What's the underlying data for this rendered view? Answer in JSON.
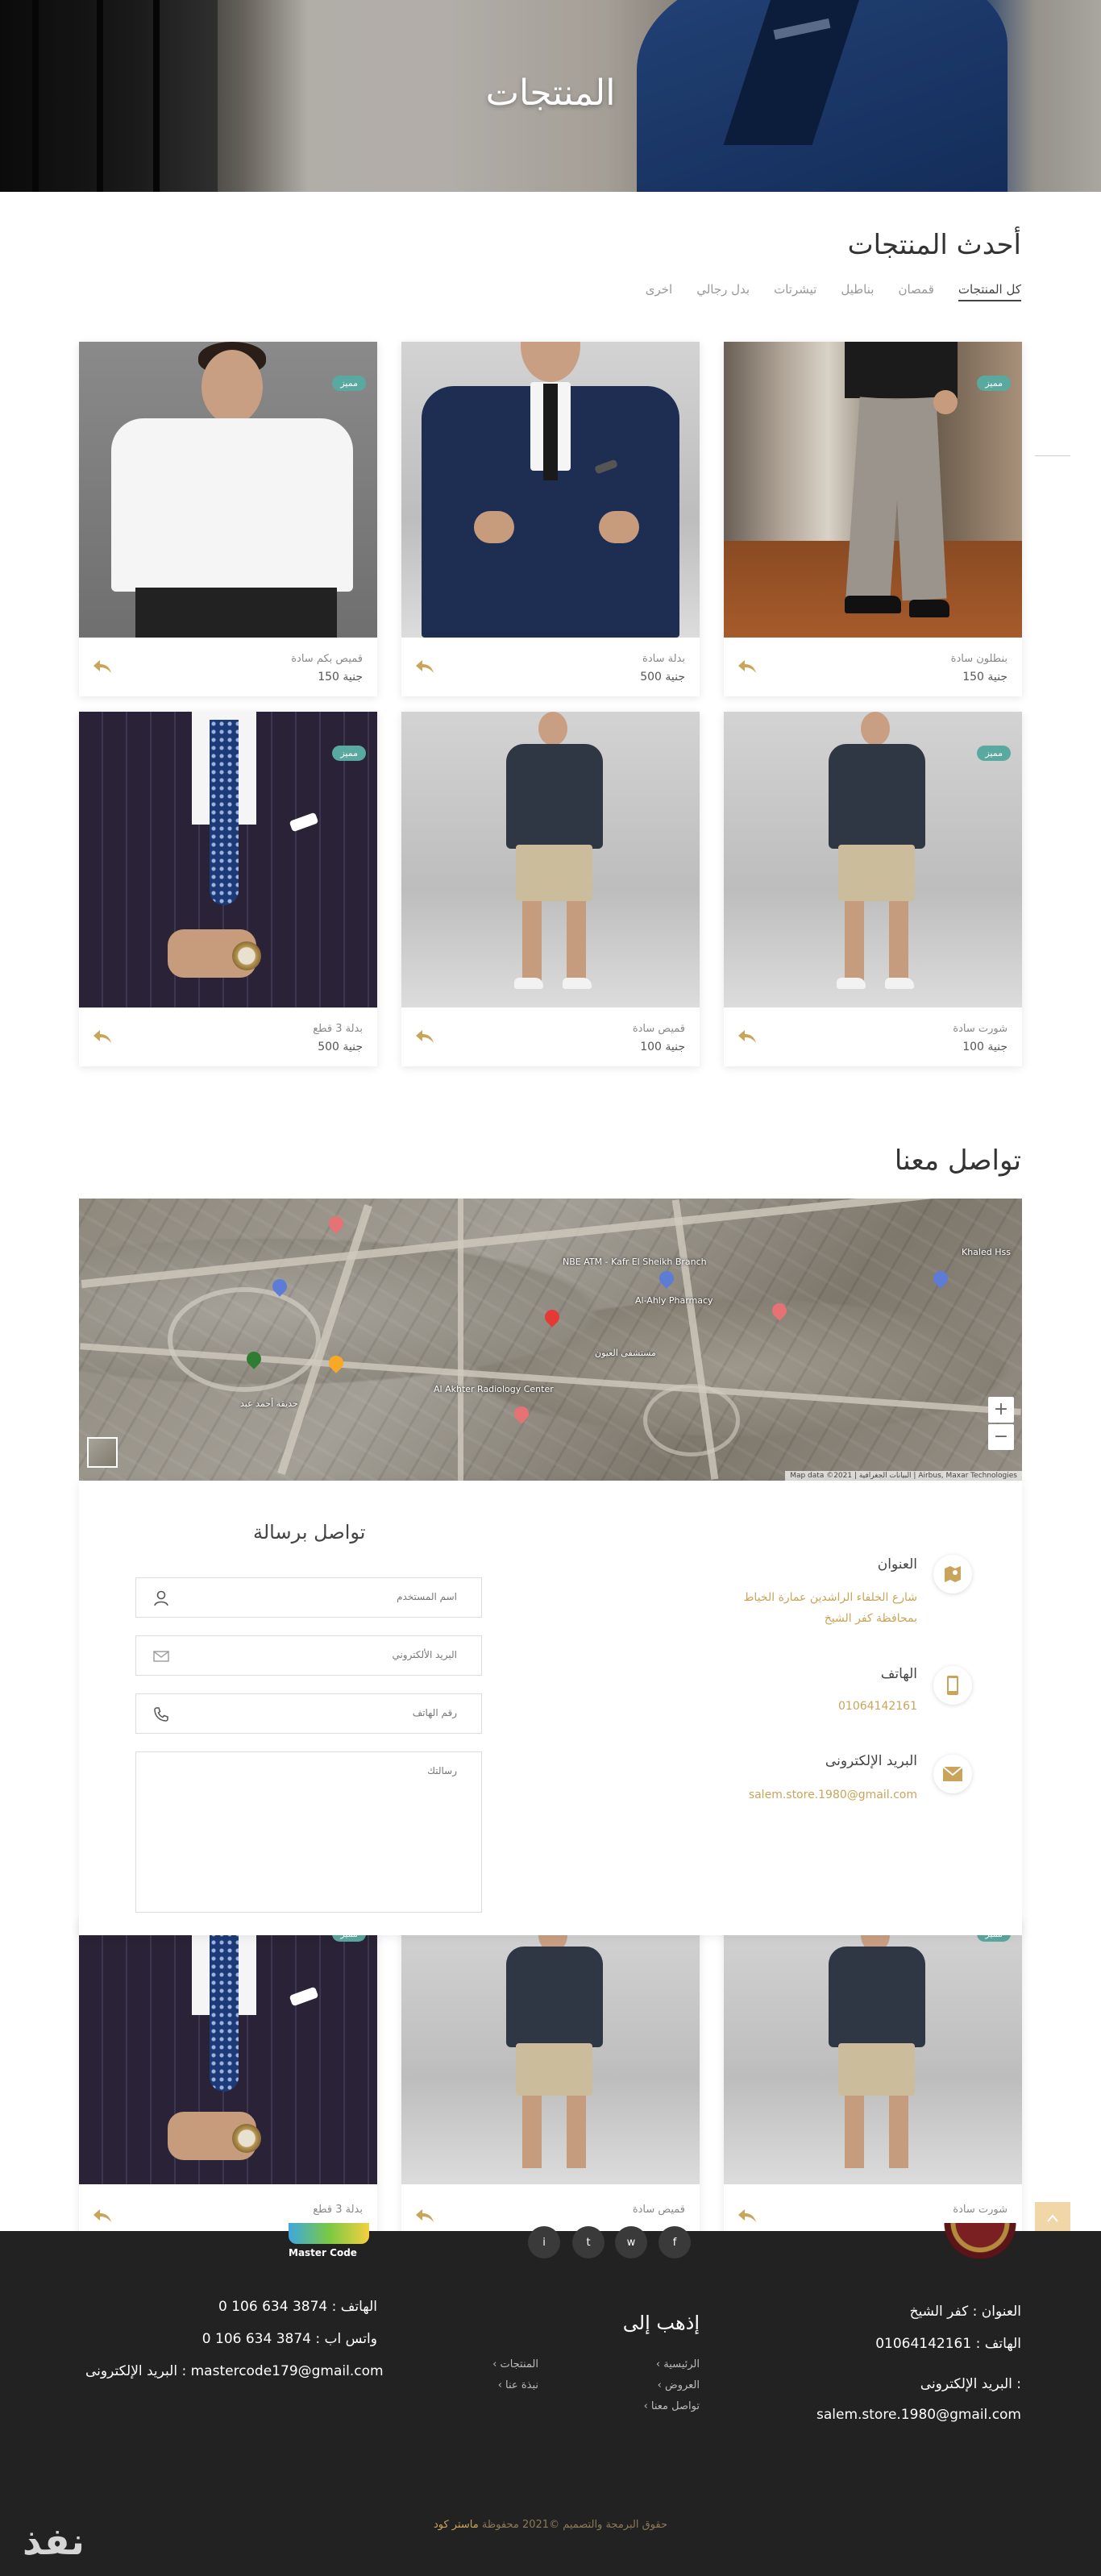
{
  "hero": {
    "title": "المنتجات"
  },
  "latest": {
    "title": "أحدث المنتجات",
    "tabs": [
      "كل المنتجات",
      "قمصان",
      "بناطيل",
      "تيشرتات",
      "بدل رجالي",
      "اخرى"
    ]
  },
  "products": [
    {
      "name": "بنطلون سادة",
      "price": "150 جنية",
      "badge": "مميز"
    },
    {
      "name": "بدلة سادة",
      "price": "500 جنية",
      "badge": ""
    },
    {
      "name": "قميص بكم سادة",
      "price": "150 جنية",
      "badge": "مميز"
    },
    {
      "name": "شورت سادة",
      "price": "100 جنية",
      "badge": "مميز"
    },
    {
      "name": "قميص سادة",
      "price": "100 جنية",
      "badge": ""
    },
    {
      "name": "بدلة 3 قطع",
      "price": "500 جنية",
      "badge": "مميز"
    }
  ],
  "overflow_products": [
    {
      "name": "شورت سادة",
      "badge": "مميز"
    },
    {
      "name": "قميص سادة",
      "badge": ""
    },
    {
      "name": "بدلة 3 قطع",
      "badge": "مميز"
    }
  ],
  "contact": {
    "title": "تواصل معنا",
    "form_title": "تواصل برسالة",
    "fields": {
      "username_placeholder": "اسم المستخدم",
      "email_placeholder": "البريد الألكتروني",
      "phone_placeholder": "رقم الهاتف",
      "message_placeholder": "رسالتك"
    },
    "address_label": "العنوان",
    "address_value": "شارع الخلفاء الراشدين عمارة الخياط بمحافظة كفر الشيخ",
    "phone_label": "الهاتف",
    "phone_value": "01064142161",
    "email_label": "البريد الإلكترونى",
    "email_value": "salem.store.1980@gmail.com"
  },
  "map": {
    "labels": [
      "NBE ATM - Kafr El Sheikh Branch",
      "Al-Ahly Pharmacy",
      "Al Akhter Radiology Center",
      "مستشفى العيون",
      "Khaled Hss",
      "حديقة أحمد عبد"
    ],
    "zoom_in": "+",
    "zoom_out": "−",
    "attribution": "Map data ©2021 | البيانات الجغرافية | Airbus, Maxar Technologies"
  },
  "footer": {
    "address": "العنوان : كفر الشيخ",
    "phone": "الهاتف : 01064142161",
    "email_label": "البريد الإلكترونى :",
    "email": "salem.store.1980@gmail.com",
    "goto_title": "إذهب إلى",
    "links_col1": [
      "الرئيسية",
      "العروض",
      "تواصل معنا"
    ],
    "links_col2": [
      "المنتجات",
      "نبذة عنا"
    ],
    "dev_phone": "الهاتف : 3874 634 106 0",
    "dev_whatsapp": "واتس اب : 3874 634 106 0",
    "dev_email": "البريد الإلكترونى : mastercode179@gmail.com",
    "dev_logo_text": "Master Code",
    "copyright_prefix": "حقوق البرمجة والتصميم ©2021 محفوظة",
    "copyright_brand": "ماستر كود",
    "watermark": "نفذ",
    "social": [
      "f",
      "w",
      "t",
      "i"
    ]
  },
  "colors": {
    "accent": "#c9a45a",
    "badge": "#5aa9a0",
    "footer": "#222222"
  }
}
